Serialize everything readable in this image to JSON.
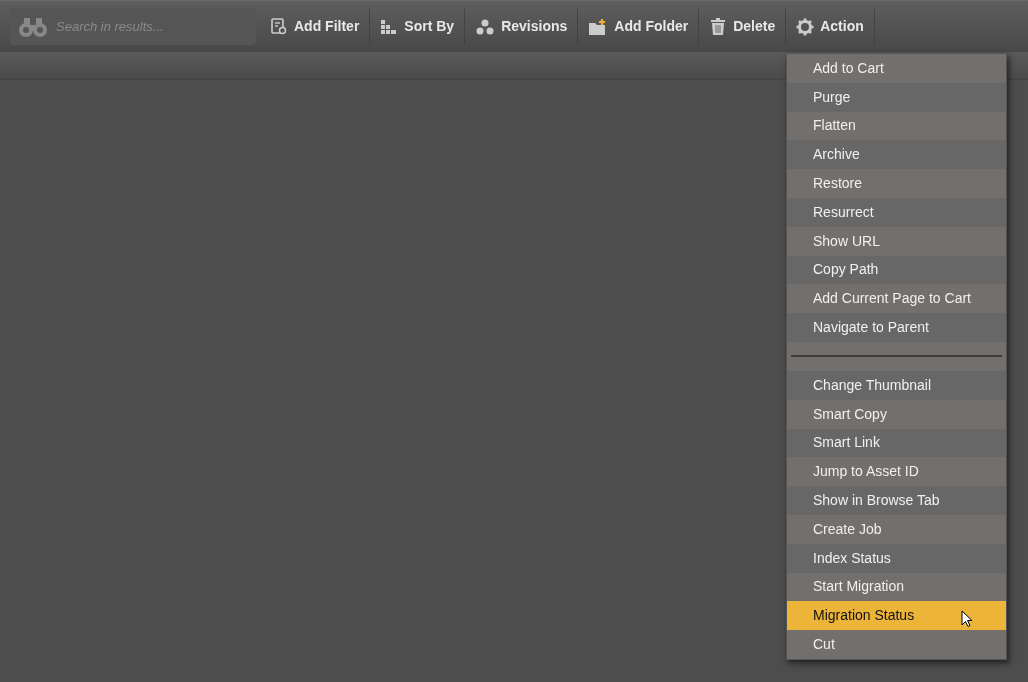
{
  "toolbar": {
    "search": {
      "placeholder": "Search in results..."
    },
    "buttons": [
      {
        "label": "Add Filter"
      },
      {
        "label": "Sort By"
      },
      {
        "label": "Revisions"
      },
      {
        "label": "Add Folder"
      },
      {
        "label": "Delete"
      },
      {
        "label": "Action"
      }
    ]
  },
  "action_menu": {
    "items": [
      {
        "kind": "item",
        "label": "Add to Cart",
        "selected": false
      },
      {
        "kind": "item",
        "label": "Purge",
        "selected": false
      },
      {
        "kind": "item",
        "label": "Flatten",
        "selected": false
      },
      {
        "kind": "item",
        "label": "Archive",
        "selected": false
      },
      {
        "kind": "item",
        "label": "Restore",
        "selected": false
      },
      {
        "kind": "item",
        "label": "Resurrect",
        "selected": false
      },
      {
        "kind": "item",
        "label": "Show URL",
        "selected": false
      },
      {
        "kind": "item",
        "label": "Copy Path",
        "selected": false
      },
      {
        "kind": "item",
        "label": "Add Current Page to Cart",
        "selected": false
      },
      {
        "kind": "item",
        "label": "Navigate to Parent",
        "selected": false
      },
      {
        "kind": "separator"
      },
      {
        "kind": "item",
        "label": "Change Thumbnail",
        "selected": false
      },
      {
        "kind": "item",
        "label": "Smart Copy",
        "selected": false
      },
      {
        "kind": "item",
        "label": "Smart Link",
        "selected": false
      },
      {
        "kind": "item",
        "label": "Jump to Asset ID",
        "selected": false
      },
      {
        "kind": "item",
        "label": "Show in Browse Tab",
        "selected": false
      },
      {
        "kind": "item",
        "label": "Create Job",
        "selected": false
      },
      {
        "kind": "item",
        "label": "Index Status",
        "selected": false
      },
      {
        "kind": "item",
        "label": "Start Migration",
        "selected": false
      },
      {
        "kind": "item",
        "label": "Migration Status",
        "selected": true
      },
      {
        "kind": "item",
        "label": "Cut",
        "selected": false
      }
    ]
  }
}
